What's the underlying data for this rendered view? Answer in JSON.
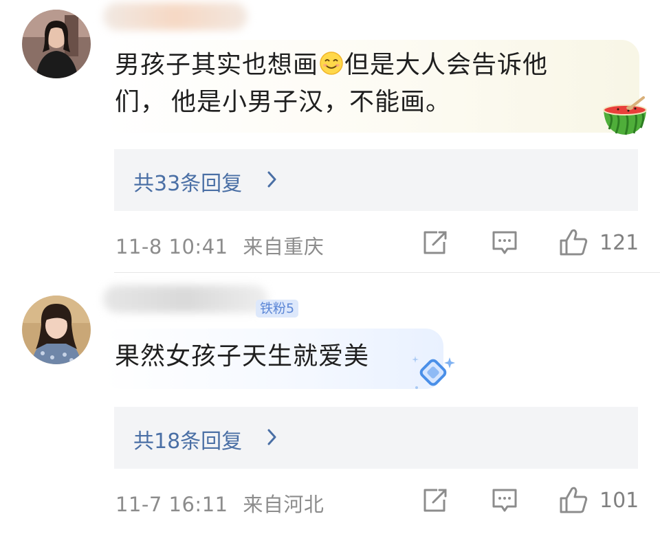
{
  "comments": [
    {
      "text_line1": "男孩子其实也想画",
      "text_line1b": "但是大人会告诉他",
      "text_line2a": "们，",
      "text_line2b": "他是小男子汉，不能画。",
      "reply_label": "共33条回复",
      "date": "11-8 10:41",
      "location": "来自重庆",
      "likes": "121"
    },
    {
      "badge": "铁粉5",
      "text": "果然女孩子天生就爱美",
      "reply_label": "共18条回复",
      "date": "11-7 16:11",
      "location": "来自河北",
      "likes": "101"
    }
  ],
  "colors": {
    "underline": "#e0131b",
    "reply_link": "#4a6fa5",
    "meta_text": "#8c8c8c"
  },
  "icons": [
    "smile-emoji-icon",
    "watermelon-icon",
    "diamond-sticker-icon",
    "share-icon",
    "comment-icon",
    "thumbs-up-icon",
    "chevron-right-icon"
  ]
}
